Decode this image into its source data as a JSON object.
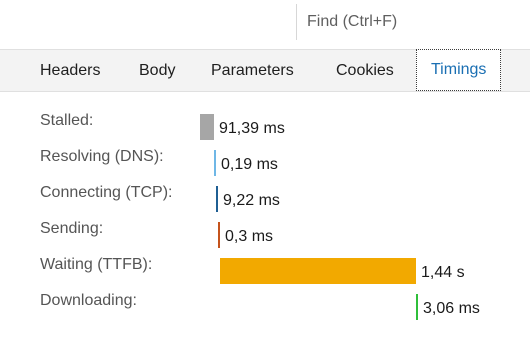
{
  "find": {
    "placeholder": "Find (Ctrl+F)"
  },
  "tabs": [
    {
      "label": "Headers"
    },
    {
      "label": "Body"
    },
    {
      "label": "Parameters"
    },
    {
      "label": "Cookies"
    },
    {
      "label": "Timings"
    }
  ],
  "active_tab": "Timings",
  "timings": [
    {
      "label": "Stalled:",
      "value": "91,39 ms",
      "duration_ms": 91.39,
      "color": "#a6a6a6"
    },
    {
      "label": "Resolving (DNS):",
      "value": "0,19 ms",
      "duration_ms": 0.19,
      "color": "#6fb7e6"
    },
    {
      "label": "Connecting (TCP):",
      "value": "9,22 ms",
      "duration_ms": 9.22,
      "color": "#1f5f93"
    },
    {
      "label": "Sending:",
      "value": "0,3 ms",
      "duration_ms": 0.3,
      "color": "#c5531c"
    },
    {
      "label": "Waiting (TTFB):",
      "value": "1,44 s",
      "duration_ms": 1440,
      "color": "#f2a900"
    },
    {
      "label": "Downloading:",
      "value": "3,06 ms",
      "duration_ms": 3.06,
      "color": "#2fbf3a"
    }
  ]
}
